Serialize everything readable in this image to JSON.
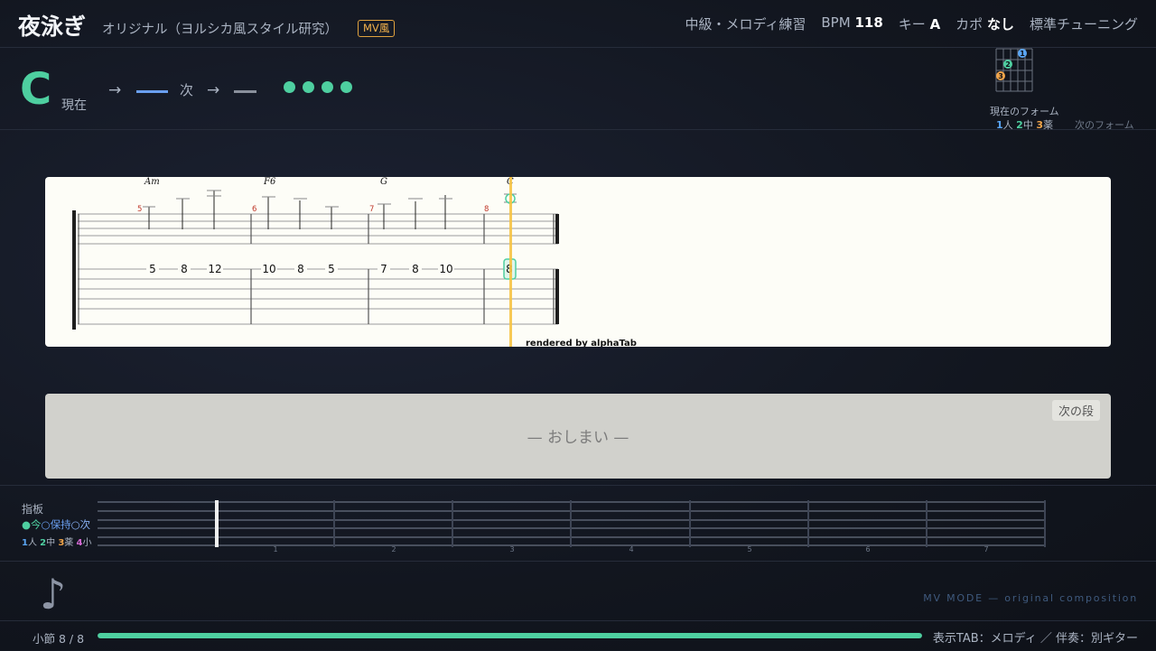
{
  "header": {
    "title": "夜泳ぎ",
    "subtitle": "オリジナル（ヨルシカ風スタイル研究）",
    "badge": "MV風",
    "level": "中級・メロディ練習",
    "bpm_label": "BPM",
    "bpm_value": "118",
    "key_label": "キー",
    "key_value": "A",
    "capo_label": "カポ",
    "capo_value": "なし",
    "tuning": "標準チューニング"
  },
  "chordbar": {
    "current_chord": "C",
    "current_label": "現在",
    "arrow": "→",
    "next_label": "次",
    "beats_total": 4,
    "current_form_label": "現在のフォーム",
    "next_form_label": "次のフォーム",
    "finger_legend": [
      {
        "num": "1",
        "name": "人"
      },
      {
        "num": "2",
        "name": "中"
      },
      {
        "num": "3",
        "name": "薬"
      }
    ],
    "diagram_fingers": [
      "1",
      "2",
      "3"
    ],
    "colors": {
      "accent": "#4ecfa0",
      "next": "#6a9ff0"
    }
  },
  "score": {
    "chords": [
      "Am",
      "F6",
      "G",
      "C"
    ],
    "measure_numbers": [
      "5",
      "6",
      "7",
      "8"
    ],
    "tab_numbers": [
      [
        "5",
        "8",
        "12"
      ],
      [
        "10",
        "8",
        "5"
      ],
      [
        "7",
        "8",
        "10"
      ],
      [
        "8"
      ]
    ],
    "credit": "rendered by alphaTab"
  },
  "next_section": {
    "button_label": "次の段",
    "end_text": "— おしまい —"
  },
  "fretboard": {
    "title": "指板",
    "legend_now": "●今",
    "legend_hold": "○保持",
    "legend_next": "○次",
    "fingers": [
      {
        "num": "1",
        "name": "人"
      },
      {
        "num": "2",
        "name": "中"
      },
      {
        "num": "3",
        "name": "薬"
      },
      {
        "num": "4",
        "name": "小"
      }
    ],
    "fret_numbers": [
      "1",
      "2",
      "3",
      "4",
      "5",
      "6",
      "7"
    ]
  },
  "footer": {
    "measure_label": "小節 8 / 8",
    "progress": 1.0,
    "tab_note": "表示TAB：メロディ ／ 伴奏：別ギター",
    "mv_mode": "MV MODE — original composition",
    "note_icon": "music-note-icon"
  }
}
